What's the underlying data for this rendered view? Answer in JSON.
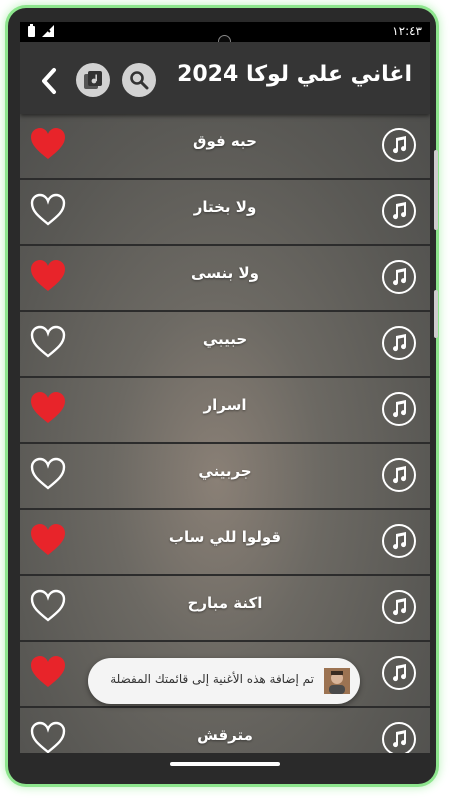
{
  "status_bar": {
    "time": "١٢:٤٣"
  },
  "toolbar": {
    "title": "اغاني علي لوكا 2024"
  },
  "songs": [
    {
      "title": "حبه فوق",
      "favorite": true
    },
    {
      "title": "ولا بختار",
      "favorite": false
    },
    {
      "title": "ولا بنسى",
      "favorite": true
    },
    {
      "title": "حبيبي",
      "favorite": false
    },
    {
      "title": "اسرار",
      "favorite": true
    },
    {
      "title": "جربيني",
      "favorite": false
    },
    {
      "title": "قولوا للي ساب",
      "favorite": true
    },
    {
      "title": "اكنة مبارح",
      "favorite": false
    },
    {
      "title": "",
      "favorite": true
    },
    {
      "title": "مترقش",
      "favorite": false
    }
  ],
  "toast": {
    "message": "تم إضافة هذه الأغنية إلى قائمتك المفضلة"
  },
  "colors": {
    "heart_filled": "#e8242a",
    "frame_glow": "#8de58d",
    "toolbar": "#353535"
  }
}
